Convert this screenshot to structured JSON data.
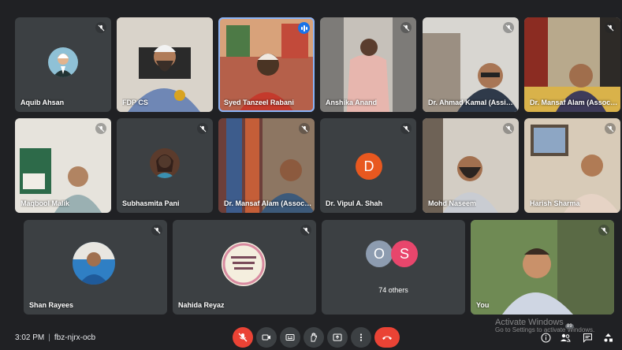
{
  "participants": [
    {
      "name": "Aquib Ahsan"
    },
    {
      "name": "FDP CS"
    },
    {
      "name": "Syed Tanzeel Rabani"
    },
    {
      "name": "Anshika Anand"
    },
    {
      "name": "Dr. Ahmad Kamal (Assist..."
    },
    {
      "name": "Dr. Mansaf Alam (Associa..."
    },
    {
      "name": "Maqbool Malik"
    },
    {
      "name": "Subhasmita Pani"
    },
    {
      "name": "Dr. Mansaf Alam (Associa..."
    },
    {
      "name": "Dr. Vipul A. Shah",
      "initial": "D"
    },
    {
      "name": "Mohd Naseem"
    },
    {
      "name": "Harish Sharma"
    },
    {
      "name": "Shan Rayees"
    },
    {
      "name": "Nahida Reyaz"
    },
    {
      "name": "You"
    }
  ],
  "others": {
    "initials": [
      "O",
      "S"
    ],
    "label": "74 others"
  },
  "meeting": {
    "time": "3:02 PM",
    "separator": "|",
    "code": "fbz-njrx-ocb"
  },
  "controls": [
    "mic-off",
    "camera",
    "captions",
    "raise-hand",
    "present",
    "more",
    "leave-call"
  ],
  "notification_count": "89",
  "watermark": {
    "title": "Activate Windows",
    "subtitle": "Go to Settings to activate Windows."
  },
  "colors": {
    "background": "#202124",
    "tile": "#3c4043",
    "end_call": "#ea4335",
    "active_speaker": "#8ab4f8",
    "letter_d": "#e8581f",
    "letter_o": "#8d9cb0",
    "letter_s": "#e8466c"
  }
}
